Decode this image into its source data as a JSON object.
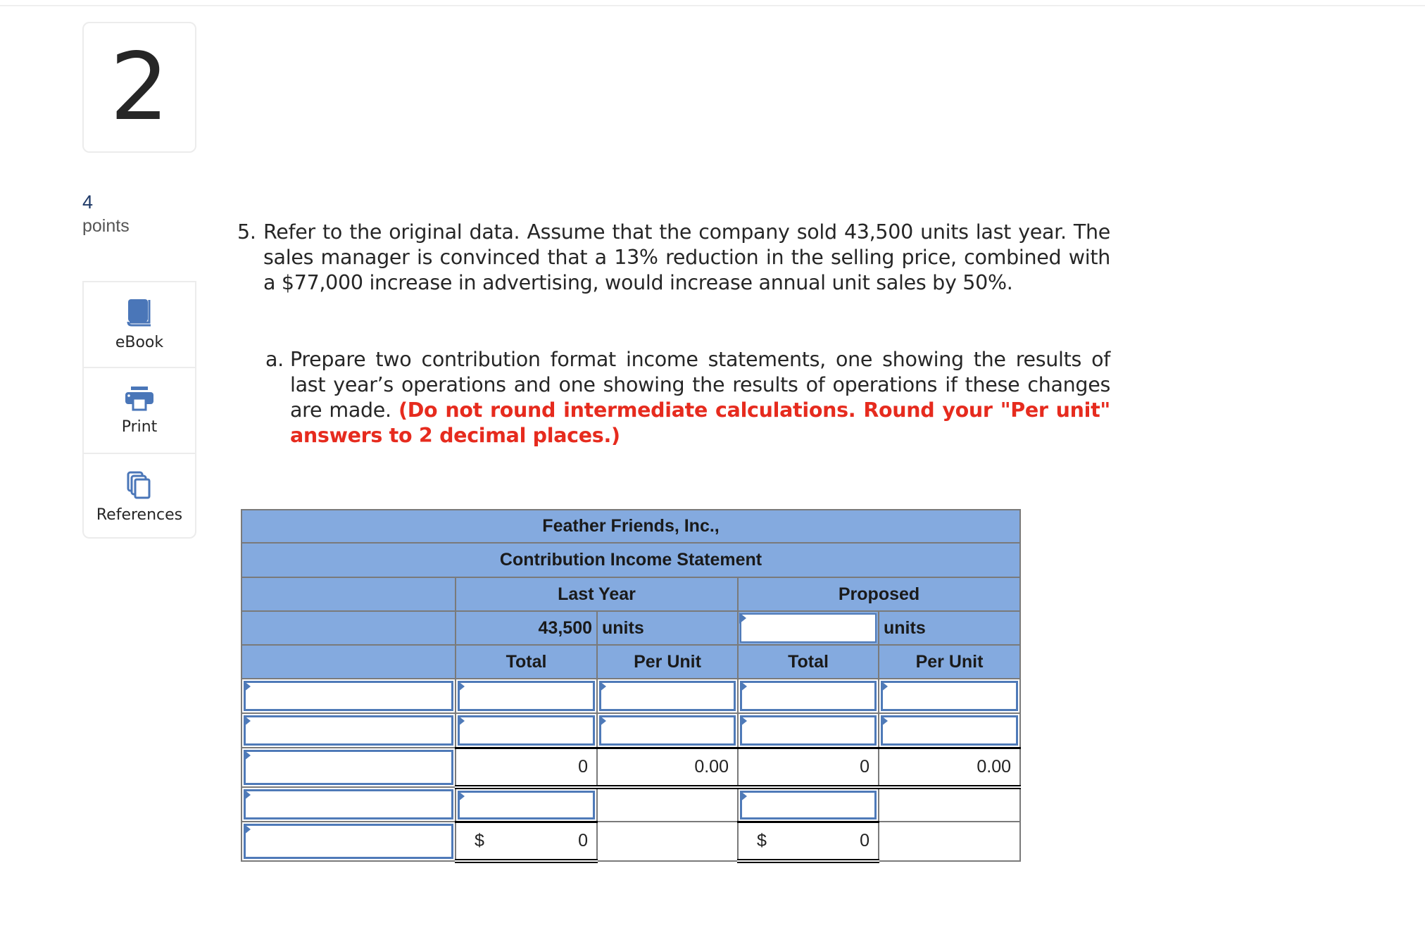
{
  "question_number": "2",
  "points": {
    "value": "4",
    "label": "points"
  },
  "tools": [
    {
      "icon": "book-icon",
      "label": "eBook"
    },
    {
      "icon": "printer-icon",
      "label": "Print"
    },
    {
      "icon": "documents-icon",
      "label": "References"
    }
  ],
  "question": {
    "number": "5.",
    "text": "Refer to the original data. Assume that the company sold 43,500 units last year. The sales manager is convinced that a 13% reduction in the selling price, combined with a $77,000 increase in advertising, would increase annual unit sales by 50%."
  },
  "part_a": {
    "label": "a.",
    "text": "Prepare two contribution format income statements, one showing the results of last year’s operations and one showing the results of operations if these changes are made.",
    "instruction": "(Do not round intermediate calculations. Round your \"Per unit\" answers to 2 decimal places.)"
  },
  "statement": {
    "company": "Feather Friends, Inc.,",
    "title": "Contribution Income Statement",
    "last_year_label": "Last Year",
    "proposed_label": "Proposed",
    "last_year_units": "43,500",
    "units_label": "units",
    "proposed_units_value": "",
    "col_total": "Total",
    "col_per_unit": "Per Unit",
    "rows": [
      {
        "label": "",
        "ly_total": "",
        "ly_per_unit": "",
        "p_total": "",
        "p_per_unit": ""
      },
      {
        "label": "",
        "ly_total": "",
        "ly_per_unit": "",
        "p_total": "",
        "p_per_unit": ""
      },
      {
        "label": "",
        "ly_total": "0",
        "ly_per_unit": "0.00",
        "p_total": "0",
        "p_per_unit": "0.00"
      },
      {
        "label": "",
        "ly_total": "",
        "p_total": ""
      },
      {
        "label": "",
        "currency": "$",
        "ly_total": "0",
        "p_total": "0"
      }
    ]
  },
  "colors": {
    "header_bg": "#84aadf",
    "input_border": "#4f7ab8",
    "instruction_red": "#e62b1e",
    "points_blue": "#1f3a68"
  }
}
